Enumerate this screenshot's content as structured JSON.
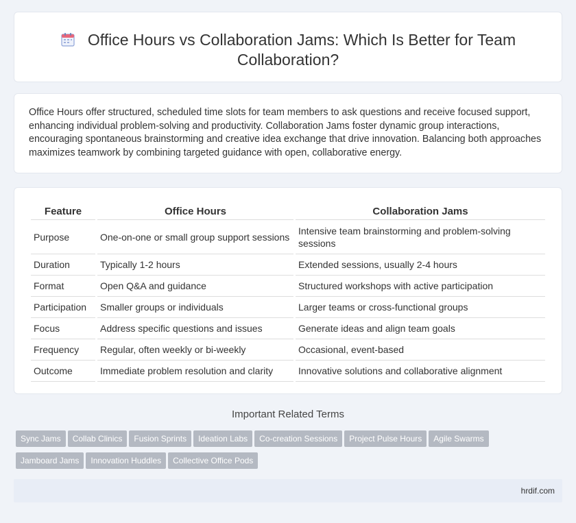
{
  "header": {
    "title": "Office Hours vs Collaboration Jams: Which Is Better for Team Collaboration?",
    "icon": "calendar-icon"
  },
  "intro": {
    "text": "Office Hours offer structured, scheduled time slots for team members to ask questions and receive focused support, enhancing individual problem-solving and productivity. Collaboration Jams foster dynamic group interactions, encouraging spontaneous brainstorming and creative idea exchange that drive innovation. Balancing both approaches maximizes teamwork by combining targeted guidance with open, collaborative energy."
  },
  "table": {
    "headers": [
      "Feature",
      "Office Hours",
      "Collaboration Jams"
    ],
    "rows": [
      [
        "Purpose",
        "One-on-one or small group support sessions",
        "Intensive team brainstorming and problem-solving sessions"
      ],
      [
        "Duration",
        "Typically 1-2 hours",
        "Extended sessions, usually 2-4 hours"
      ],
      [
        "Format",
        "Open Q&A and guidance",
        "Structured workshops with active participation"
      ],
      [
        "Participation",
        "Smaller groups or individuals",
        "Larger teams or cross-functional groups"
      ],
      [
        "Focus",
        "Address specific questions and issues",
        "Generate ideas and align team goals"
      ],
      [
        "Frequency",
        "Regular, often weekly or bi-weekly",
        "Occasional, event-based"
      ],
      [
        "Outcome",
        "Immediate problem resolution and clarity",
        "Innovative solutions and collaborative alignment"
      ]
    ]
  },
  "related": {
    "heading": "Important Related Terms",
    "tags": [
      "Sync Jams",
      "Collab Clinics",
      "Fusion Sprints",
      "Ideation Labs",
      "Co-creation Sessions",
      "Project Pulse Hours",
      "Agile Swarms",
      "Jamboard Jams",
      "Innovation Huddles",
      "Collective Office Pods"
    ]
  },
  "footer": {
    "site": "hrdif.com"
  }
}
